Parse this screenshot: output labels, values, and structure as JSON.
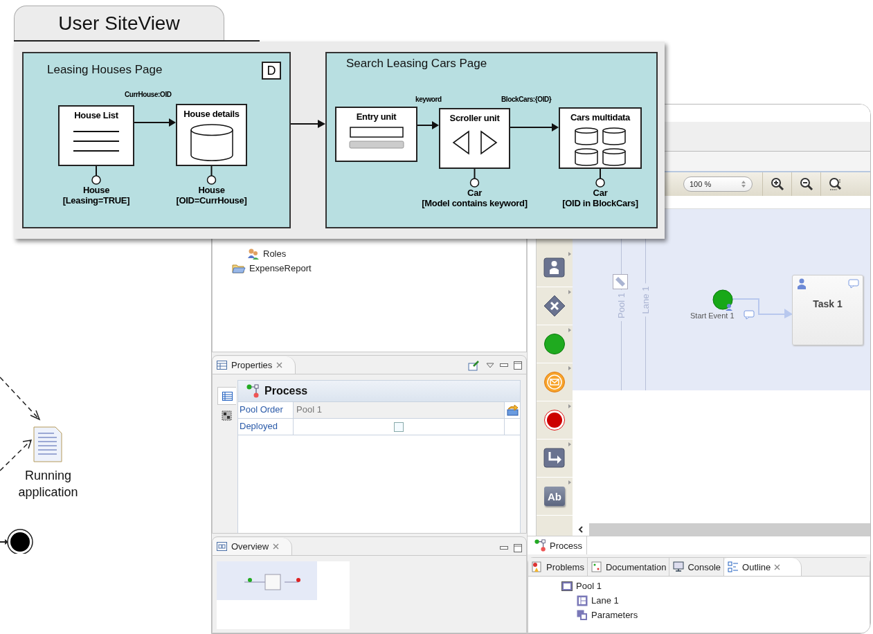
{
  "activity": {
    "node_label": "Running application"
  },
  "siteview": {
    "title": "User SiteView",
    "pages": [
      {
        "title": "Leasing Houses Page",
        "badge": "D",
        "links": [
          "CurrHouse:OID"
        ],
        "units": [
          {
            "kind": "index",
            "title": "House List",
            "entity": "House",
            "condition": "[Leasing=TRUE]"
          },
          {
            "kind": "data",
            "title": "House details",
            "entity": "House",
            "condition": "[OID=CurrHouse]"
          }
        ]
      },
      {
        "title": "Search Leasing Cars Page",
        "links": [
          "keyword",
          "BlockCars:{OID}"
        ],
        "units": [
          {
            "kind": "entry",
            "title": "Entry unit"
          },
          {
            "kind": "scroller",
            "title": "Scroller unit",
            "entity": "Car",
            "condition": "[Model contains keyword]"
          },
          {
            "kind": "multidata",
            "title": "Cars multidata",
            "entity": "Car",
            "condition": "[OID in BlockCars]"
          }
        ]
      }
    ]
  },
  "explorer": {
    "tree": [
      {
        "children": [
          {
            "kind": "roles",
            "label": "Roles"
          }
        ]
      },
      {
        "kind": "folder",
        "label": "ExpenseReport"
      }
    ]
  },
  "properties": {
    "tab": "Properties",
    "side_tabs": [
      {
        "selected": true
      },
      {
        "selected": false
      }
    ],
    "section": "Process",
    "rows": [
      {
        "kind": "text",
        "name": "Pool Order",
        "value": "Pool 1"
      },
      {
        "kind": "checkbox",
        "name": "Deployed",
        "checked": false
      }
    ]
  },
  "overview": {
    "tab": "Overview"
  },
  "editor": {
    "zoom": "100 %",
    "palette": [
      {
        "kind": "actor"
      },
      {
        "kind": "gateway"
      },
      {
        "kind": "start"
      },
      {
        "kind": "message"
      },
      {
        "kind": "end"
      },
      {
        "kind": "sequence"
      },
      {
        "kind": "text",
        "label": "Ab"
      }
    ],
    "diagram": {
      "pool": "Pool 1",
      "lane": "Lane 1",
      "start_event": "Start Event 1",
      "task": "Task 1"
    },
    "tab": "Process"
  },
  "bottom_tabs": [
    {
      "label": "Problems",
      "selected": false
    },
    {
      "label": "Documentation",
      "selected": false
    },
    {
      "label": "Console",
      "selected": false
    },
    {
      "label": "Outline",
      "selected": true
    }
  ],
  "outline": [
    {
      "label": "Pool 1",
      "children": [
        {
          "label": "Lane 1"
        },
        {
          "label": "Parameters"
        }
      ]
    }
  ]
}
